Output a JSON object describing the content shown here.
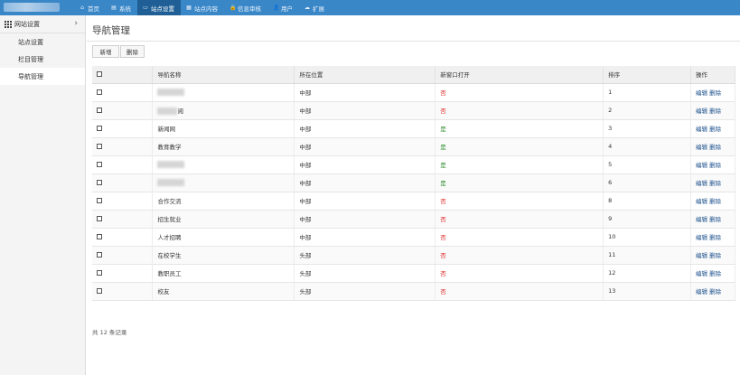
{
  "topbar": {
    "colors": {
      "bar": "#3a87c8",
      "active": "#1f5f96"
    },
    "nav": [
      {
        "icon": "home-icon",
        "glyph": "⌂",
        "label": "首页"
      },
      {
        "icon": "list-icon",
        "glyph": "▤",
        "label": "系统"
      },
      {
        "icon": "monitor-icon",
        "glyph": "▭",
        "label": "站点设置",
        "active": true
      },
      {
        "icon": "table-icon",
        "glyph": "▦",
        "label": "站点内容"
      },
      {
        "icon": "lock-icon",
        "glyph": "🔒",
        "label": "信息审核"
      },
      {
        "icon": "user-icon",
        "glyph": "👤",
        "label": "用户"
      },
      {
        "icon": "cloud-icon",
        "glyph": "☁",
        "label": "扩展"
      }
    ]
  },
  "sidebar": {
    "header": "网站设置",
    "items": [
      {
        "label": "站点设置"
      },
      {
        "label": "栏目管理"
      },
      {
        "label": "导航管理",
        "active": true
      }
    ]
  },
  "main": {
    "title": "导航管理",
    "buttons": {
      "add": "新增",
      "delete": "删除"
    },
    "columns": [
      "导航名称",
      "所在位置",
      "新窗口打开",
      "排序",
      "操作"
    ],
    "actions": {
      "edit": "编辑",
      "delete": "删除"
    },
    "rows": [
      {
        "name": "",
        "blurred": true,
        "blur_w": 30,
        "position": "中部",
        "new_window": "否",
        "sort": "1"
      },
      {
        "name": "阅",
        "blurred": true,
        "blur_w": 22,
        "position": "中部",
        "new_window": "否",
        "sort": "2"
      },
      {
        "name": "新闻网",
        "position": "中部",
        "new_window": "是",
        "sort": "3"
      },
      {
        "name": "教育教学",
        "position": "中部",
        "new_window": "是",
        "sort": "4"
      },
      {
        "name": "",
        "blurred": true,
        "blur_w": 30,
        "position": "中部",
        "new_window": "是",
        "sort": "5"
      },
      {
        "name": "",
        "blurred": true,
        "blur_w": 30,
        "position": "中部",
        "new_window": "是",
        "sort": "6"
      },
      {
        "name": "合作交流",
        "position": "中部",
        "new_window": "否",
        "sort": "8"
      },
      {
        "name": "招生就业",
        "position": "中部",
        "new_window": "否",
        "sort": "9"
      },
      {
        "name": "人才招聘",
        "position": "中部",
        "new_window": "否",
        "sort": "10"
      },
      {
        "name": "在校学生",
        "position": "头部",
        "new_window": "否",
        "sort": "11"
      },
      {
        "name": "教职员工",
        "position": "头部",
        "new_window": "否",
        "sort": "12"
      },
      {
        "name": "校友",
        "position": "头部",
        "new_window": "否",
        "sort": "13"
      }
    ],
    "footer": "共 12 条记录"
  }
}
